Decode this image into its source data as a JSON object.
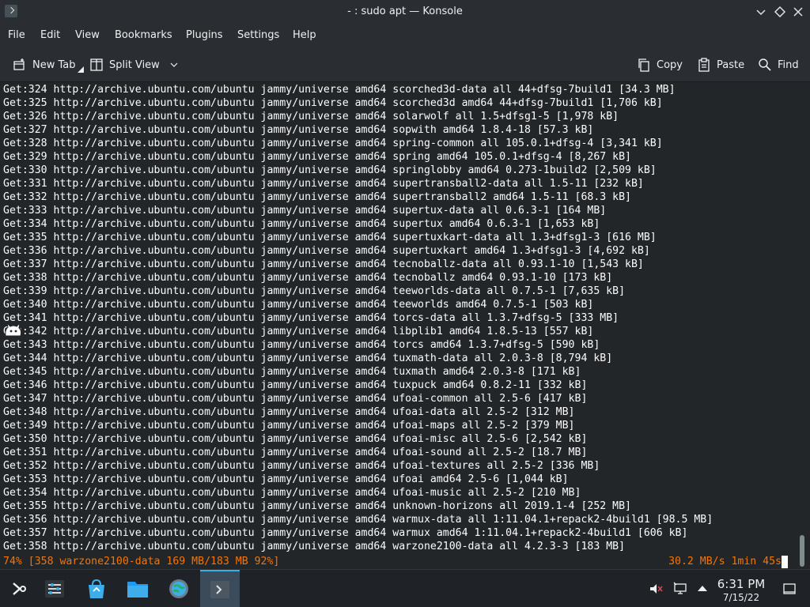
{
  "window": {
    "title": "- : sudo apt — Konsole"
  },
  "menubar": {
    "items": [
      "File",
      "Edit",
      "View",
      "Bookmarks",
      "Plugins",
      "Settings",
      "Help"
    ]
  },
  "toolbar": {
    "new_tab": "New Tab",
    "split_view": "Split View",
    "copy": "Copy",
    "paste": "Paste",
    "find": "Find"
  },
  "terminal": {
    "lines": [
      "Get:324 http://archive.ubuntu.com/ubuntu jammy/universe amd64 scorched3d-data all 44+dfsg-7build1 [34.3 MB]",
      "Get:325 http://archive.ubuntu.com/ubuntu jammy/universe amd64 scorched3d amd64 44+dfsg-7build1 [1,706 kB]",
      "Get:326 http://archive.ubuntu.com/ubuntu jammy/universe amd64 solarwolf all 1.5+dfsg1-5 [1,978 kB]",
      "Get:327 http://archive.ubuntu.com/ubuntu jammy/universe amd64 sopwith amd64 1.8.4-18 [57.3 kB]",
      "Get:328 http://archive.ubuntu.com/ubuntu jammy/universe amd64 spring-common all 105.0.1+dfsg-4 [3,341 kB]",
      "Get:329 http://archive.ubuntu.com/ubuntu jammy/universe amd64 spring amd64 105.0.1+dfsg-4 [8,267 kB]",
      "Get:330 http://archive.ubuntu.com/ubuntu jammy/universe amd64 springlobby amd64 0.273-1build2 [2,509 kB]",
      "Get:331 http://archive.ubuntu.com/ubuntu jammy/universe amd64 supertransball2-data all 1.5-11 [232 kB]",
      "Get:332 http://archive.ubuntu.com/ubuntu jammy/universe amd64 supertransball2 amd64 1.5-11 [68.3 kB]",
      "Get:333 http://archive.ubuntu.com/ubuntu jammy/universe amd64 supertux-data all 0.6.3-1 [164 MB]",
      "Get:334 http://archive.ubuntu.com/ubuntu jammy/universe amd64 supertux amd64 0.6.3-1 [1,653 kB]",
      "Get:335 http://archive.ubuntu.com/ubuntu jammy/universe amd64 supertuxkart-data all 1.3+dfsg1-3 [616 MB]",
      "Get:336 http://archive.ubuntu.com/ubuntu jammy/universe amd64 supertuxkart amd64 1.3+dfsg1-3 [4,692 kB]",
      "Get:337 http://archive.ubuntu.com/ubuntu jammy/universe amd64 tecnoballz-data all 0.93.1-10 [1,543 kB]",
      "Get:338 http://archive.ubuntu.com/ubuntu jammy/universe amd64 tecnoballz amd64 0.93.1-10 [173 kB]",
      "Get:339 http://archive.ubuntu.com/ubuntu jammy/universe amd64 teeworlds-data all 0.7.5-1 [7,635 kB]",
      "Get:340 http://archive.ubuntu.com/ubuntu jammy/universe amd64 teeworlds amd64 0.7.5-1 [503 kB]",
      "Get:341 http://archive.ubuntu.com/ubuntu jammy/universe amd64 torcs-data all 1.3.7+dfsg-5 [333 MB]",
      "Get:342 http://archive.ubuntu.com/ubuntu jammy/universe amd64 libplib1 amd64 1.8.5-13 [557 kB]",
      "Get:343 http://archive.ubuntu.com/ubuntu jammy/universe amd64 torcs amd64 1.3.7+dfsg-5 [590 kB]",
      "Get:344 http://archive.ubuntu.com/ubuntu jammy/universe amd64 tuxmath-data all 2.0.3-8 [8,794 kB]",
      "Get:345 http://archive.ubuntu.com/ubuntu jammy/universe amd64 tuxmath amd64 2.0.3-8 [171 kB]",
      "Get:346 http://archive.ubuntu.com/ubuntu jammy/universe amd64 tuxpuck amd64 0.8.2-11 [332 kB]",
      "Get:347 http://archive.ubuntu.com/ubuntu jammy/universe amd64 ufoai-common all 2.5-6 [417 kB]",
      "Get:348 http://archive.ubuntu.com/ubuntu jammy/universe amd64 ufoai-data all 2.5-2 [312 MB]",
      "Get:349 http://archive.ubuntu.com/ubuntu jammy/universe amd64 ufoai-maps all 2.5-2 [379 MB]",
      "Get:350 http://archive.ubuntu.com/ubuntu jammy/universe amd64 ufoai-misc all 2.5-6 [2,542 kB]",
      "Get:351 http://archive.ubuntu.com/ubuntu jammy/universe amd64 ufoai-sound all 2.5-2 [18.7 MB]",
      "Get:352 http://archive.ubuntu.com/ubuntu jammy/universe amd64 ufoai-textures all 2.5-2 [336 MB]",
      "Get:353 http://archive.ubuntu.com/ubuntu jammy/universe amd64 ufoai amd64 2.5-6 [1,044 kB]",
      "Get:354 http://archive.ubuntu.com/ubuntu jammy/universe amd64 ufoai-music all 2.5-2 [210 MB]",
      "Get:355 http://archive.ubuntu.com/ubuntu jammy/universe amd64 unknown-horizons all 2019.1-4 [252 MB]",
      "Get:356 http://archive.ubuntu.com/ubuntu jammy/universe amd64 warmux-data all 1:11.04.1+repack2-4build1 [98.5 MB]",
      "Get:357 http://archive.ubuntu.com/ubuntu jammy/universe amd64 warmux amd64 1:11.04.1+repack2-4build1 [606 kB]",
      "Get:358 http://archive.ubuntu.com/ubuntu jammy/universe amd64 warzone2100-data all 4.2.3-3 [183 MB]"
    ],
    "progress_left": "74% [358 warzone2100-data 169 MB/183 MB 92%]",
    "progress_right": "30.2 MB/s 1min 45s",
    "status_color": "#f67400"
  },
  "taskbar": {
    "time": "6:31 PM",
    "date": "7/15/22"
  },
  "colors": {
    "accent": "#3daee9",
    "window_bg": "#2a2e32",
    "terminal_bg": "#232629"
  }
}
